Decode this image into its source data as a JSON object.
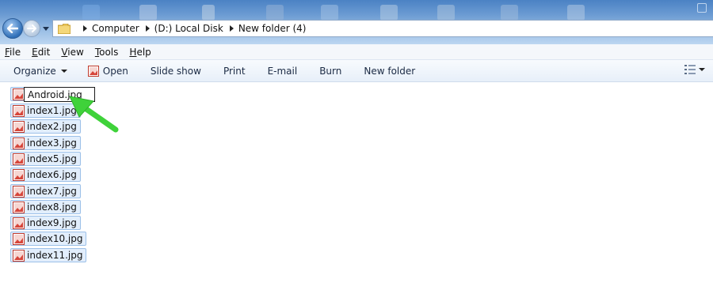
{
  "address_bar": {
    "crumbs": [
      "Computer",
      "(D:) Local Disk",
      "New folder (4)"
    ]
  },
  "menu": {
    "items": [
      {
        "key": "F",
        "rest": "ile"
      },
      {
        "key": "E",
        "rest": "dit"
      },
      {
        "key": "V",
        "rest": "iew"
      },
      {
        "key": "T",
        "rest": "ools"
      },
      {
        "key": "H",
        "rest": "elp"
      }
    ]
  },
  "toolbar": {
    "organize": "Organize",
    "open": "Open",
    "slideshow": "Slide show",
    "print": "Print",
    "email": "E-mail",
    "burn": "Burn",
    "new_folder": "New folder"
  },
  "rename": {
    "value": "Android.jpg"
  },
  "files": [
    "index1.jpg",
    "index2.jpg",
    "index3.jpg",
    "index5.jpg",
    "index6.jpg",
    "index7.jpg",
    "index8.jpg",
    "index9.jpg",
    "index10.jpg",
    "index11.jpg"
  ],
  "colors": {
    "selection_fill": "#e2eefc",
    "selection_border": "#9cc0e8",
    "arrow": "#3fd23a"
  }
}
